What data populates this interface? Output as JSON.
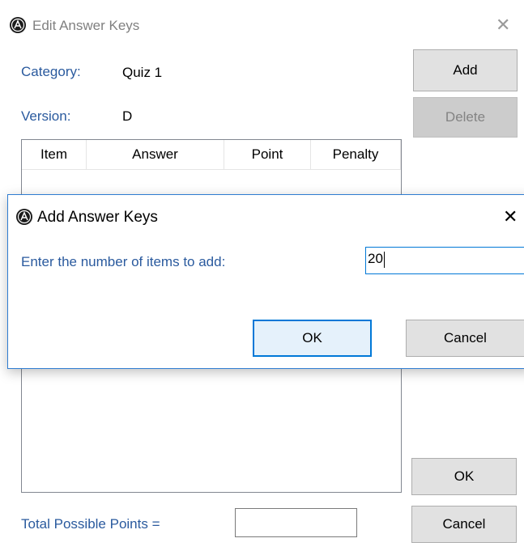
{
  "main_window": {
    "title": "Edit Answer Keys",
    "close_glyph": "✕",
    "category_label": "Category:",
    "category_value": "Quiz 1",
    "version_label": "Version:",
    "version_value": "D",
    "add_button": "Add",
    "delete_button": "Delete",
    "columns": [
      "Item",
      "Answer",
      "Point",
      "Penalty"
    ],
    "ok_button": "OK",
    "cancel_button": "Cancel",
    "total_label": "Total Possible Points =",
    "total_value": ""
  },
  "dialog": {
    "title": "Add Answer Keys",
    "close_glyph": "✕",
    "prompt": "Enter the number of items to add:",
    "input_value": "20",
    "ok_button": "OK",
    "cancel_button": "Cancel"
  },
  "colors": {
    "label_blue": "#2a5a9e",
    "dialog_border": "#2e7cd1",
    "button_face": "#e1e1e1",
    "focus_blue": "#0078d7"
  },
  "icons": [
    "app-logo-icon",
    "close-icon"
  ]
}
